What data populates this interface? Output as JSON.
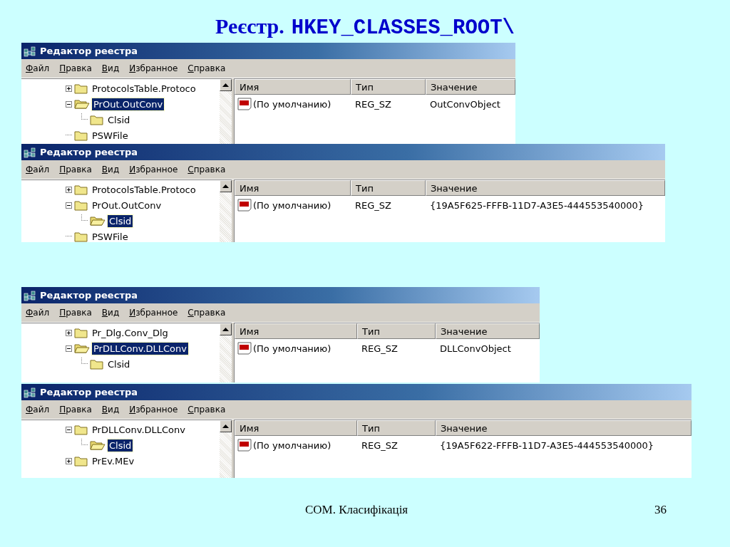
{
  "slide": {
    "title_prefix": "Реєстр.",
    "title_path": "HKEY_CLASSES_ROOT\\"
  },
  "groups": [
    {
      "windows": [
        {
          "title": "Редактор реестра",
          "menu": [
            "Файл",
            "Правка",
            "Вид",
            "Избранное",
            "Справка"
          ],
          "tree": [
            {
              "label": "ProtocolsTable.Protoco",
              "kind": "branch",
              "expanded": false,
              "selected": false
            },
            {
              "label": "PrOut.OutConv",
              "kind": "branch",
              "expanded": true,
              "selected": true,
              "children": [
                {
                  "label": "Clsid",
                  "kind": "leaf",
                  "selected": false
                }
              ]
            },
            {
              "label": "PSWFile",
              "kind": "leaf",
              "selected": false
            }
          ],
          "columns": [
            "Имя",
            "Тип",
            "Значение"
          ],
          "rows": [
            {
              "name": "(По умолчанию)",
              "type": "REG_SZ",
              "value": "OutConvObject"
            }
          ]
        },
        {
          "title": "Редактор реестра",
          "menu": [
            "Файл",
            "Правка",
            "Вид",
            "Избранное",
            "Справка"
          ],
          "tree": [
            {
              "label": "ProtocolsTable.Protoco",
              "kind": "branch",
              "expanded": false,
              "selected": false
            },
            {
              "label": "PrOut.OutConv",
              "kind": "branch",
              "expanded": true,
              "selected": false,
              "children": [
                {
                  "label": "Clsid",
                  "kind": "leaf",
                  "selected": true
                }
              ]
            },
            {
              "label": "PSWFile",
              "kind": "leaf",
              "selected": false
            }
          ],
          "columns": [
            "Имя",
            "Тип",
            "Значение"
          ],
          "rows": [
            {
              "name": "(По умолчанию)",
              "type": "REG_SZ",
              "value": "{19A5F625-FFFB-11D7-A3E5-444553540000}"
            }
          ]
        }
      ]
    },
    {
      "windows": [
        {
          "title": "Редактор реестра",
          "menu": [
            "Файл",
            "Правка",
            "Вид",
            "Избранное",
            "Справка"
          ],
          "tree": [
            {
              "label": "Pr_Dlg.Conv_Dlg",
              "kind": "branch",
              "expanded": false,
              "selected": false
            },
            {
              "label": "PrDLLConv.DLLConv",
              "kind": "branch",
              "expanded": true,
              "selected": true,
              "children": [
                {
                  "label": "Clsid",
                  "kind": "leaf",
                  "selected": false
                }
              ]
            }
          ],
          "columns": [
            "Имя",
            "Тип",
            "Значение"
          ],
          "rows": [
            {
              "name": "(По умолчанию)",
              "type": "REG_SZ",
              "value": "DLLConvObject"
            }
          ]
        },
        {
          "title": "Редактор реестра",
          "menu": [
            "Файл",
            "Правка",
            "Вид",
            "Избранное",
            "Справка"
          ],
          "tree": [
            {
              "label": "PrDLLConv.DLLConv",
              "kind": "branch",
              "expanded": true,
              "selected": false,
              "children": [
                {
                  "label": "Clsid",
                  "kind": "leaf",
                  "selected": true
                }
              ]
            },
            {
              "label": "PrEv.MEv",
              "kind": "branch",
              "expanded": false,
              "selected": false
            }
          ],
          "columns": [
            "Имя",
            "Тип",
            "Значение"
          ],
          "rows": [
            {
              "name": "(По умолчанию)",
              "type": "REG_SZ",
              "value": "{19A5F622-FFFB-11D7-A3E5-444553540000}"
            }
          ]
        }
      ]
    }
  ],
  "footer": {
    "caption": "COM. Класифікація",
    "page": "36"
  }
}
